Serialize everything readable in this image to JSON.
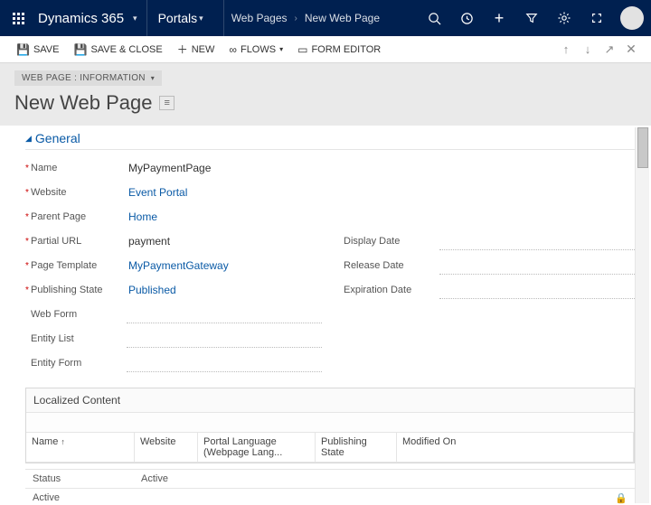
{
  "topnav": {
    "brand": "Dynamics 365",
    "module": "Portals",
    "breadcrumb": [
      "Web Pages",
      "New Web Page"
    ]
  },
  "cmdbar": {
    "save": "SAVE",
    "saveclose": "SAVE & CLOSE",
    "new": "NEW",
    "flows": "FLOWS",
    "formeditor": "FORM EDITOR"
  },
  "subhead": {
    "entity": "WEB PAGE : INFORMATION",
    "title": "New Web Page"
  },
  "section": {
    "general": "General"
  },
  "fields": {
    "name_label": "Name",
    "name_value": "MyPaymentPage",
    "website_label": "Website",
    "website_value": "Event Portal",
    "parent_label": "Parent Page",
    "parent_value": "Home",
    "partialurl_label": "Partial URL",
    "partialurl_value": "payment",
    "template_label": "Page Template",
    "template_value": "MyPaymentGateway",
    "pubstate_label": "Publishing State",
    "pubstate_value": "Published",
    "webform_label": "Web Form",
    "entitylist_label": "Entity List",
    "entityform_label": "Entity Form",
    "displaydate_label": "Display Date",
    "releasedate_label": "Release Date",
    "expirationdate_label": "Expiration Date"
  },
  "subgrid": {
    "title": "Localized Content",
    "cols": {
      "name": "Name",
      "website": "Website",
      "lang": "Portal Language (Webpage Lang...",
      "pubstate": "Publishing State",
      "modified": "Modified On"
    }
  },
  "status": {
    "status_label": "Status",
    "status_value": "Active",
    "active_label": "Active"
  }
}
